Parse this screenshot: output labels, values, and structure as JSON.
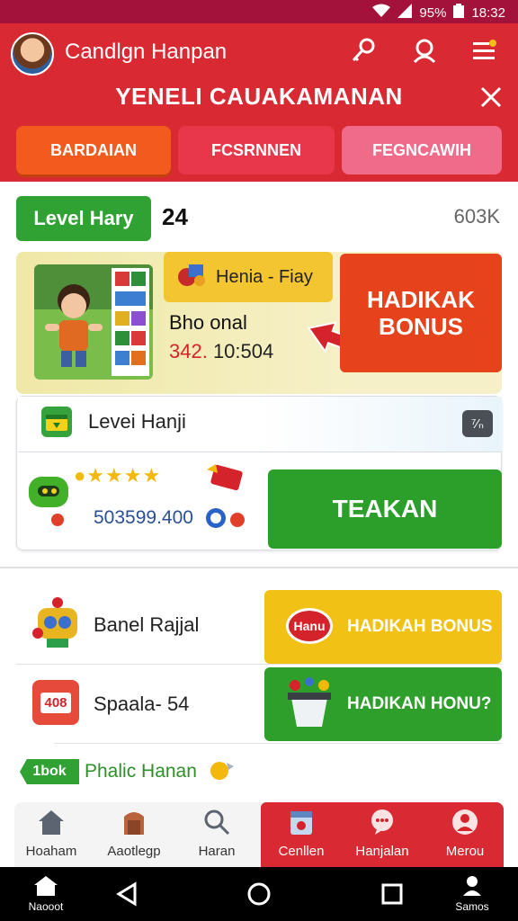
{
  "status_bar": {
    "battery": "95%",
    "time": "18:32"
  },
  "header": {
    "username": "Candlgn Hanpan",
    "title": "YENELI CAUAKAMANAN",
    "tabs": [
      {
        "label": "BARDAIAN"
      },
      {
        "label": "FCSRNNEN"
      },
      {
        "label": "FEGNCAWIH"
      }
    ]
  },
  "level": {
    "badge": "Level Hary",
    "number": "24",
    "right_value": "603K"
  },
  "promo": {
    "tag": "Henia - Fiay",
    "subtitle": "Bho onal",
    "value_red": "342.",
    "value_rest": " 10:504",
    "bonus_line1": "HADIKAK",
    "bonus_line2": "BONUS"
  },
  "level_card": {
    "label": "Levei Hanji",
    "right_icon": "⁷⁄ₙ",
    "amount": "503599.400",
    "action": "TEAKAN"
  },
  "rewards": [
    {
      "label": "Banel Rajjal",
      "button": "HADIKAH BONUS",
      "badge": "Hanu"
    },
    {
      "label": "Spaala- 54",
      "button": "HADIKAN HONU?",
      "icon_text": "408"
    }
  ],
  "promo_tag": {
    "tag": "1bok",
    "text": "Phalic Hanan"
  },
  "bottom_nav": [
    {
      "label": "Hoaham",
      "icon": "home-icon"
    },
    {
      "label": "Aaotlegp",
      "icon": "door-icon"
    },
    {
      "label": "Haran",
      "icon": "search-icon"
    },
    {
      "label": "Cenllen",
      "icon": "calendar-icon"
    },
    {
      "label": "Hanjalan",
      "icon": "chat-icon"
    },
    {
      "label": "Merou",
      "icon": "profile-icon"
    }
  ],
  "system_nav": {
    "home_label": "Naooot",
    "profile_label": "Samos"
  },
  "colors": {
    "header_red": "#d92a33",
    "green": "#2fa233",
    "orange": "#e6431d",
    "yellow": "#f2c116"
  }
}
